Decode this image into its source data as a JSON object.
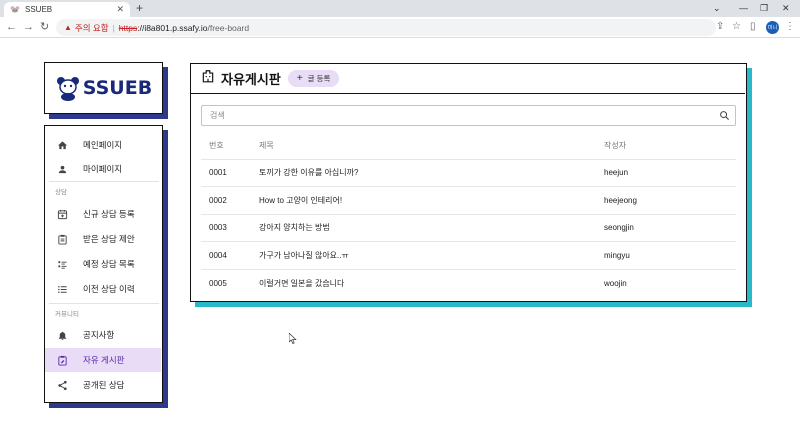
{
  "browser": {
    "tab_title": "SSUEB",
    "new_tab": "+",
    "security_warning": "주의 요함",
    "url_scheme": "https",
    "url_host": "://i8a801.p.ssafy.io",
    "url_path": "/free-board",
    "profile_initials": "미니"
  },
  "logo": {
    "text": "SSUEB"
  },
  "sidebar": {
    "items_top": [
      {
        "label": "메인페이지",
        "icon": "home-icon"
      },
      {
        "label": "마이페이지",
        "icon": "person-icon"
      }
    ],
    "section_consult": "상담",
    "items_consult": [
      {
        "label": "신규 상담 등록",
        "icon": "calendar-add-icon"
      },
      {
        "label": "받은 상담 제안",
        "icon": "clipboard-icon"
      },
      {
        "label": "예정 상담 목록",
        "icon": "checklist-icon"
      },
      {
        "label": "이전 상담 이력",
        "icon": "list-icon"
      }
    ],
    "section_community": "커뮤니티",
    "items_community": [
      {
        "label": "공지사항",
        "icon": "bell-icon"
      },
      {
        "label": "자유 게시판",
        "icon": "clipboard-edit-icon",
        "active": true
      },
      {
        "label": "공개된 상담",
        "icon": "share-icon"
      }
    ]
  },
  "board": {
    "title": "자유게시판",
    "write_button": "글 등록",
    "search_placeholder": "검색",
    "columns": {
      "no": "번호",
      "title": "제목",
      "author": "작성자"
    },
    "rows": [
      {
        "no": "0001",
        "title": "토끼가 강한 이유를 아십니까?",
        "author": "heejun"
      },
      {
        "no": "0002",
        "title": "How to 고양이 인테리어!",
        "author": "heejeong"
      },
      {
        "no": "0003",
        "title": "강아지 양치하는 방법",
        "author": "seongjin"
      },
      {
        "no": "0004",
        "title": "가구가 남아나질 않아요..ㅠ",
        "author": "mingyu"
      },
      {
        "no": "0005",
        "title": "이럴거면 일본을 갔습니다",
        "author": "woojin"
      }
    ]
  },
  "colors": {
    "sidebar_shadow": "#2d3a8c",
    "board_shadow": "#2ab9c6",
    "active_bg": "#e9dcf7",
    "active_text": "#5b2ca8"
  }
}
